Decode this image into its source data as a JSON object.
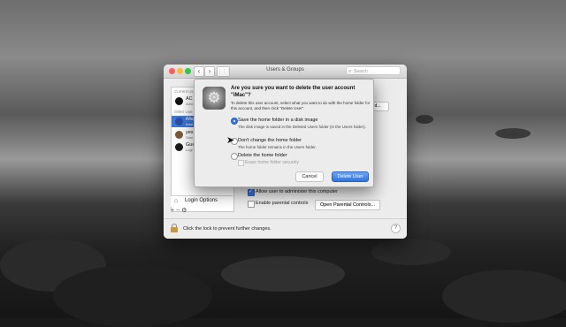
{
  "window": {
    "title": "Users & Groups",
    "search_placeholder": "Search",
    "nav": {
      "back": "‹",
      "forward": "›",
      "grid": "⋮⋮⋮"
    }
  },
  "sidebar": {
    "current_caption": "Current Us",
    "other_caption": "Other Use",
    "users": [
      {
        "name": "AC",
        "role": "Adm",
        "avatar_color": "#111111"
      },
      {
        "name": "iMac",
        "role": "Adm",
        "avatar_color": "#2a4fa0"
      },
      {
        "name": "yes",
        "role": "Stan",
        "avatar_color": "#7a5a3a"
      },
      {
        "name": "Gue",
        "role": "Logi",
        "avatar_color": "#1a1a1a"
      }
    ],
    "login_options": "Login Options",
    "add_remove": "+ −  ⚙"
  },
  "main": {
    "edit_button": "d...",
    "allow_admin": {
      "label": "Allow user to administer this computer",
      "checked": true
    },
    "parental": {
      "label": "Enable parental controls",
      "checked": false
    },
    "parental_button": "Open Parental Controls..."
  },
  "bottom": {
    "lock_text": "Click the lock to prevent further changes.",
    "help": "?"
  },
  "dialog": {
    "title": "Are you sure you want to delete the user account \"iMac\"?",
    "description": "To delete this user account, select what you want to do with the home folder for this account, and then click \"Delete User\".",
    "options": [
      {
        "label": "Save the home folder in a disk image",
        "sub": "The disk image is saved in the Deleted Users folder (in the Users folder).",
        "selected": true
      },
      {
        "label": "Don't change the home folder",
        "sub": "The home folder remains in the Users folder.",
        "selected": false
      },
      {
        "label": "Delete the home folder",
        "sub": "",
        "selected": false
      }
    ],
    "erase_label": "Erase home folder securely",
    "cancel": "Cancel",
    "delete": "Delete User"
  },
  "colors": {
    "accent": "#3b76d6",
    "lock": "#c9983a"
  }
}
